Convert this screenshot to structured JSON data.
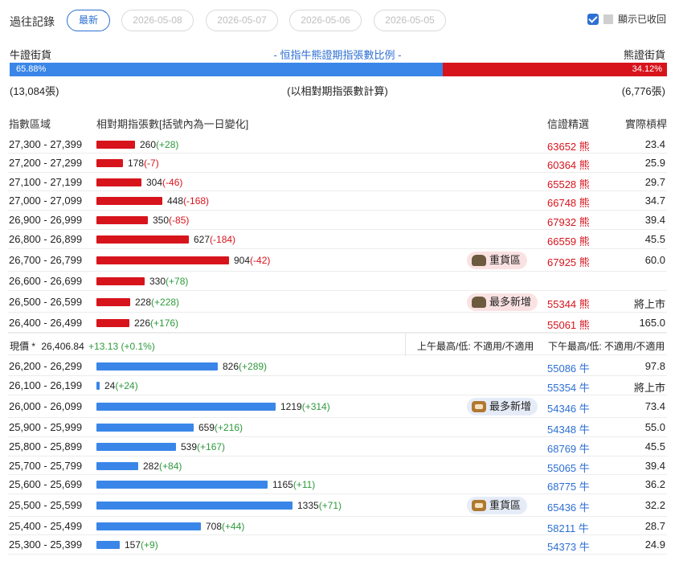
{
  "header": {
    "label": "過往記錄",
    "tabs": [
      "最新",
      "2026-05-08",
      "2026-05-07",
      "2026-05-06",
      "2026-05-05"
    ],
    "show_expired_label": "顯示已收回"
  },
  "ratio": {
    "bull_label": "牛證街貨",
    "bear_label": "熊證街貨",
    "title": "- 恒指牛熊證期指張數比例 -",
    "bull_pct": "65.88%",
    "bear_pct": "34.12%",
    "bull_count": "(13,084張)",
    "bear_count": "(6,776張)",
    "note": "(以相對期指張數計算)"
  },
  "columns": {
    "range": "指數區域",
    "contracts": "相對期指張數[括號內為一日變化]",
    "warrant": "信證精選",
    "strike": "實際槓桿"
  },
  "bear_rows": [
    {
      "range": "27,300 - 27,399",
      "value": "260",
      "change": "(+28)",
      "code": "63652 熊",
      "strike": "23.4",
      "tag": ""
    },
    {
      "range": "27,200 - 27,299",
      "value": "178",
      "change": "(-7)",
      "code": "60364 熊",
      "strike": "25.9",
      "tag": ""
    },
    {
      "range": "27,100 - 27,199",
      "value": "304",
      "change": "(-46)",
      "code": "65528 熊",
      "strike": "29.7",
      "tag": ""
    },
    {
      "range": "27,000 - 27,099",
      "value": "448",
      "change": "(-168)",
      "code": "66748 熊",
      "strike": "34.7",
      "tag": ""
    },
    {
      "range": "26,900 - 26,999",
      "value": "350",
      "change": "(-85)",
      "code": "67932 熊",
      "strike": "39.4",
      "tag": ""
    },
    {
      "range": "26,800 - 26,899",
      "value": "627",
      "change": "(-184)",
      "code": "66559 熊",
      "strike": "45.5",
      "tag": ""
    },
    {
      "range": "26,700 - 26,799",
      "value": "904",
      "change": "(-42)",
      "code": "67925 熊",
      "strike": "60.0",
      "tag": "重貨區"
    },
    {
      "range": "26,600 - 26,699",
      "value": "330",
      "change": "(+78)",
      "code": "",
      "strike": "",
      "tag": ""
    },
    {
      "range": "26,500 - 26,599",
      "value": "228",
      "change": "(+228)",
      "code": "55344 熊",
      "strike": "將上市",
      "tag": "最多新增"
    },
    {
      "range": "26,400 - 26,499",
      "value": "226",
      "change": "(+176)",
      "code": "55061 熊",
      "strike": "165.0",
      "tag": ""
    }
  ],
  "current": {
    "label": "現價 *",
    "price": "26,406.84",
    "change": "+13.13 (+0.1%)",
    "am": "上午最高/低: 不適用/不適用",
    "pm": "下午最高/低: 不適用/不適用"
  },
  "bull_rows": [
    {
      "range": "26,200 - 26,299",
      "value": "826",
      "change": "(+289)",
      "code": "55086 牛",
      "strike": "97.8",
      "tag": ""
    },
    {
      "range": "26,100 - 26,199",
      "value": "24",
      "change": "(+24)",
      "code": "55354 牛",
      "strike": "將上市",
      "tag": ""
    },
    {
      "range": "26,000 - 26,099",
      "value": "1219",
      "change": "(+314)",
      "code": "54346 牛",
      "strike": "73.4",
      "tag": "最多新增"
    },
    {
      "range": "25,900 - 25,999",
      "value": "659",
      "change": "(+216)",
      "code": "54348 牛",
      "strike": "55.0",
      "tag": ""
    },
    {
      "range": "25,800 - 25,899",
      "value": "539",
      "change": "(+167)",
      "code": "68769 牛",
      "strike": "45.5",
      "tag": ""
    },
    {
      "range": "25,700 - 25,799",
      "value": "282",
      "change": "(+84)",
      "code": "55065 牛",
      "strike": "39.4",
      "tag": ""
    },
    {
      "range": "25,600 - 25,699",
      "value": "1165",
      "change": "(+11)",
      "code": "68775 牛",
      "strike": "36.2",
      "tag": ""
    },
    {
      "range": "25,500 - 25,599",
      "value": "1335",
      "change": "(+71)",
      "code": "65436 牛",
      "strike": "32.2",
      "tag": "重貨區"
    },
    {
      "range": "25,400 - 25,499",
      "value": "708",
      "change": "(+44)",
      "code": "58211 牛",
      "strike": "28.7",
      "tag": ""
    },
    {
      "range": "25,300 - 25,399",
      "value": "157",
      "change": "(+9)",
      "code": "54373 牛",
      "strike": "24.9",
      "tag": ""
    }
  ],
  "colors": {
    "bear": "#d7141c",
    "bull": "#3a86e8",
    "up": "#2e9a3c",
    "accent": "#2d6fd3"
  }
}
